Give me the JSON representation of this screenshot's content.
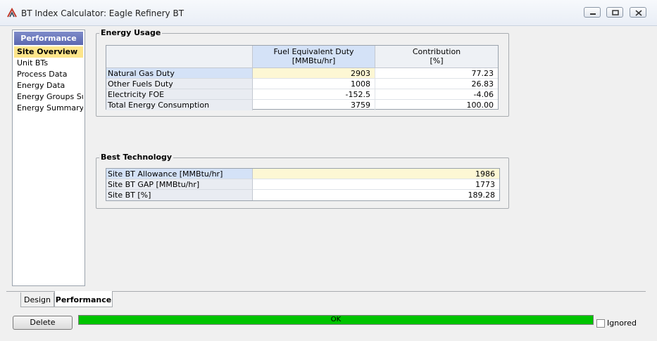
{
  "window": {
    "title": "BT Index Calculator: Eagle Refinery BT"
  },
  "sidebar": {
    "header": "Performance",
    "items": [
      {
        "label": "Site Overview",
        "selected": true
      },
      {
        "label": "Unit BTs"
      },
      {
        "label": "Process Data"
      },
      {
        "label": "Energy Data"
      },
      {
        "label": "Energy Groups Sur"
      },
      {
        "label": "Energy Summary"
      }
    ]
  },
  "energy_usage": {
    "title": "Energy Usage",
    "columns": [
      {
        "line1": "Fuel Equivalent Duty",
        "line2": "[MMBtu/hr]"
      },
      {
        "line1": "Contribution",
        "line2": "[%]"
      }
    ],
    "rows": [
      {
        "label": "Natural Gas Duty",
        "duty": "2903",
        "contribution": "77.23"
      },
      {
        "label": "Other Fuels Duty",
        "duty": "1008",
        "contribution": "26.83"
      },
      {
        "label": "Electricity FOE",
        "duty": "-152.5",
        "contribution": "-4.06"
      },
      {
        "label": "Total Energy Consumption",
        "duty": "3759",
        "contribution": "100.00"
      }
    ]
  },
  "best_technology": {
    "title": "Best Technology",
    "rows": [
      {
        "label": "Site BT Allowance [MMBtu/hr]",
        "value": "1986"
      },
      {
        "label": "Site BT GAP [MMBtu/hr]",
        "value": "1773"
      },
      {
        "label": "Site BT [%]",
        "value": "189.28"
      }
    ]
  },
  "tabs": [
    {
      "label": "Design"
    },
    {
      "label": "Performance",
      "active": true
    }
  ],
  "footer": {
    "delete_label": "Delete",
    "status": "OK",
    "ignored_label": "Ignored",
    "ignored_checked": false
  },
  "colors": {
    "status_ok": "#00c400",
    "selection": "#fde58a",
    "sidebar_header": "#6b77bd"
  }
}
